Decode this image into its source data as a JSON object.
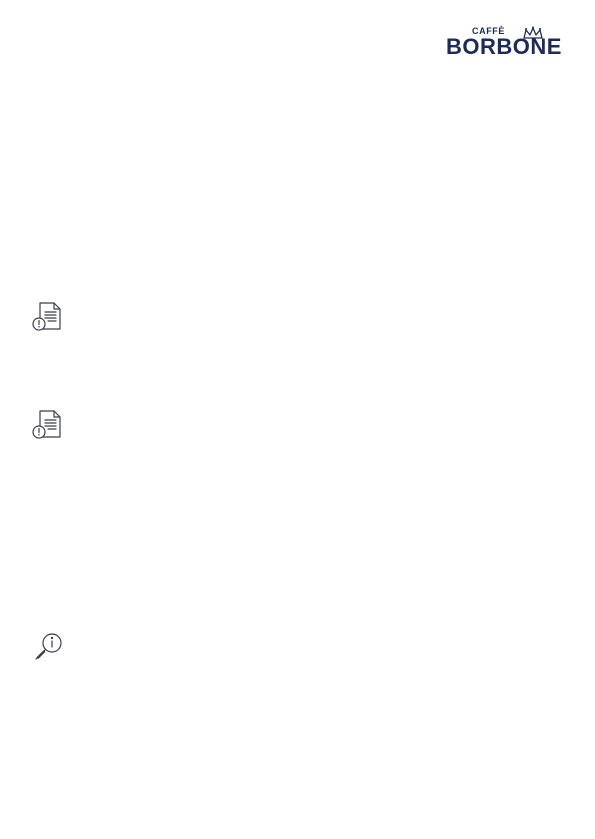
{
  "header": {
    "logo": {
      "line1": "CAFFÈ",
      "line2": "BORBONE",
      "color": "#1d2b57"
    }
  },
  "icons": [
    {
      "name": "document-clock-icon"
    },
    {
      "name": "document-clock-icon"
    },
    {
      "name": "magnifier-info-icon"
    }
  ],
  "colors": {
    "icon_stroke": "#3a3f4a",
    "background": "#ffffff"
  }
}
